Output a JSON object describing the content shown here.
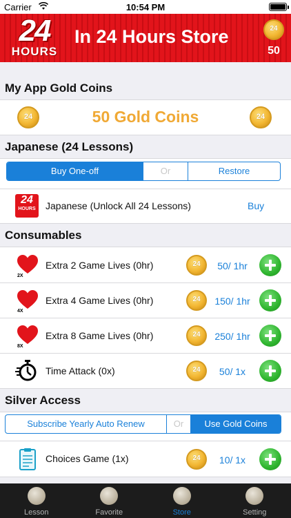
{
  "status_bar": {
    "carrier": "Carrier",
    "time": "10:54 PM"
  },
  "header": {
    "logo_number": "24",
    "logo_word": "HOURS",
    "title": "In 24 Hours Store",
    "coin_count": "50"
  },
  "gold": {
    "section_title": "My App Gold Coins",
    "amount_text": "50 Gold Coins"
  },
  "japanese": {
    "section_title": "Japanese (24 Lessons)",
    "segments": [
      "Buy One-off",
      "Or",
      "Restore"
    ],
    "item_label": "Japanese (Unlock All 24 Lessons)",
    "buy_label": "Buy"
  },
  "consumables": {
    "section_title": "Consumables",
    "items": [
      {
        "label": "Extra 2 Game Lives (0hr)",
        "price": "50/ 1hr",
        "badge": "2X",
        "icon": "heart-icon"
      },
      {
        "label": "Extra 4 Game Lives (0hr)",
        "price": "150/ 1hr",
        "badge": "4X",
        "icon": "heart-icon"
      },
      {
        "label": "Extra 8 Game Lives (0hr)",
        "price": "250/ 1hr",
        "badge": "8X",
        "icon": "heart-icon"
      },
      {
        "label": "Time Attack (0x)",
        "price": "50/ 1x",
        "badge": "",
        "icon": "stopwatch-icon"
      }
    ]
  },
  "silver": {
    "section_title": "Silver Access",
    "segments": [
      "Subscribe Yearly Auto Renew",
      "Or",
      "Use Gold Coins"
    ],
    "items": [
      {
        "label": "Choices Game (1x)",
        "price": "10/ 1x",
        "icon": "clipboard-icon"
      }
    ]
  },
  "tabs": [
    {
      "label": "Lesson",
      "active": false
    },
    {
      "label": "Favorite",
      "active": false
    },
    {
      "label": "Store",
      "active": true
    },
    {
      "label": "Setting",
      "active": false
    }
  ],
  "colors": {
    "header_red": "#e2141b",
    "accent_blue": "#1a80d9",
    "gold_text": "#f0a935",
    "plus_green": "#2fb52f"
  }
}
